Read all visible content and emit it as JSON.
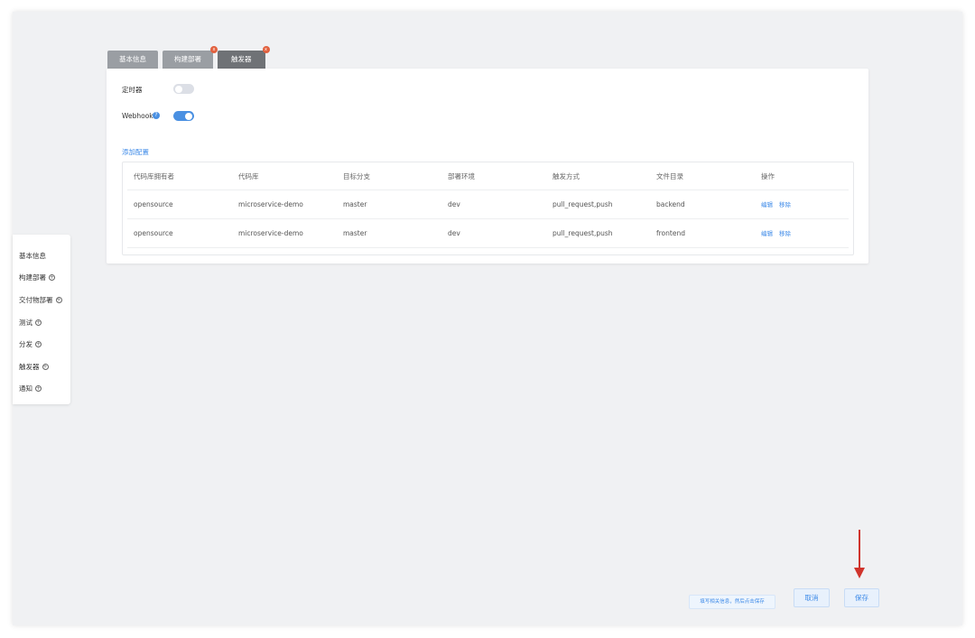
{
  "tabs": [
    {
      "label": "基本信息",
      "active": false,
      "badge": ""
    },
    {
      "label": "构建部署",
      "active": false,
      "badge": "x"
    },
    {
      "label": "触发器",
      "active": true,
      "badge": "x"
    }
  ],
  "timer": {
    "label": "定时器",
    "enabled": false
  },
  "webhook": {
    "label": "Webhook",
    "enabled": true,
    "help_icon": "question-circle-icon"
  },
  "add_config_label": "添加配置",
  "table": {
    "headers": [
      "代码库拥有者",
      "代码库",
      "目标分支",
      "部署环境",
      "触发方式",
      "文件目录",
      "操作"
    ],
    "rows": [
      {
        "owner": "opensource",
        "repo": "microservice-demo",
        "branch": "master",
        "env": "dev",
        "trigger": "pull_request,push",
        "dir": "backend",
        "edit": "编辑",
        "remove": "移除"
      },
      {
        "owner": "opensource",
        "repo": "microservice-demo",
        "branch": "master",
        "env": "dev",
        "trigger": "pull_request,push",
        "dir": "frontend",
        "edit": "编辑",
        "remove": "移除"
      }
    ]
  },
  "sidenav": {
    "items": [
      {
        "label": "基本信息",
        "has_plus": false
      },
      {
        "label": "构建部署",
        "has_plus": true
      },
      {
        "label": "交付物部署",
        "has_plus": true
      },
      {
        "label": "测试",
        "has_plus": true
      },
      {
        "label": "分发",
        "has_plus": true
      },
      {
        "label": "触发器",
        "has_plus": true
      },
      {
        "label": "通知",
        "has_plus": true
      }
    ]
  },
  "footer": {
    "hint": "填写相关信息，然后点击保存",
    "cancel_label": "取消",
    "save_label": "保存"
  },
  "colors": {
    "accent": "#3d8ae8",
    "arrow": "#d0342c",
    "badge": "#e2613f"
  }
}
